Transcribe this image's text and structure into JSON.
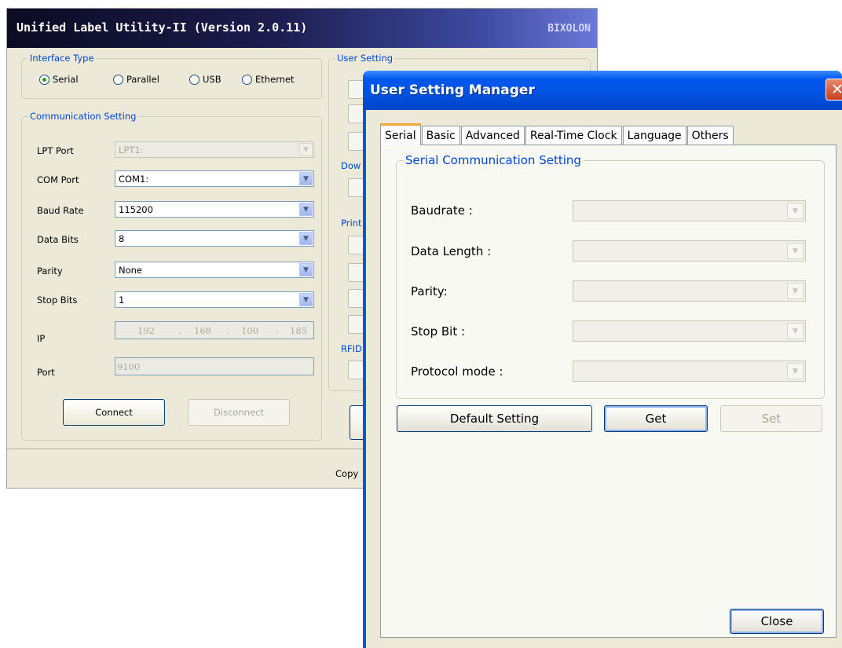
{
  "main": {
    "title": "Unified Label Utility-II (Version 2.0.11)",
    "brand": "BIXOLON",
    "interface_type": {
      "legend": "Interface Type",
      "options": [
        "Serial",
        "Parallel",
        "USB",
        "Ethernet"
      ],
      "selected": "Serial"
    },
    "comm": {
      "legend": "Communication Setting",
      "lpt_label": "LPT Port",
      "lpt_value": "LPT1:",
      "com_label": "COM Port",
      "com_value": "COM1:",
      "baud_label": "Baud Rate",
      "baud_value": "115200",
      "databits_label": "Data Bits",
      "databits_value": "8",
      "parity_label": "Parity",
      "parity_value": "None",
      "stopbits_label": "Stop Bits",
      "stopbits_value": "1",
      "ip_label": "IP",
      "ip": [
        "192",
        "168",
        "100",
        "185"
      ],
      "port_label": "Port",
      "port_value": "9100",
      "connect": "Connect",
      "disconnect": "Disconnect"
    },
    "right_groups": {
      "user_setting": "User Setting",
      "download": "Dow",
      "print": "Print",
      "rfid": "RFID"
    },
    "status_text": "Copy"
  },
  "dialog": {
    "title": "User Setting Manager",
    "tabs": [
      "Serial",
      "Basic",
      "Advanced",
      "Real-Time Clock",
      "Language",
      "Others"
    ],
    "selected_tab": "Serial",
    "group_legend": "Serial Communication Setting",
    "fields": {
      "baudrate": "Baudrate :",
      "data_length": "Data Length :",
      "parity": "Parity:",
      "stop_bit": "Stop Bit :",
      "protocol_mode": "Protocol mode :"
    },
    "buttons": {
      "default": "Default Setting",
      "get": "Get",
      "set": "Set",
      "close": "Close"
    },
    "close_glyph": "✕"
  },
  "colors": {
    "title_blue": "#0055e5",
    "legend_blue": "#0046d5",
    "window_bg": "#ece9d8"
  }
}
